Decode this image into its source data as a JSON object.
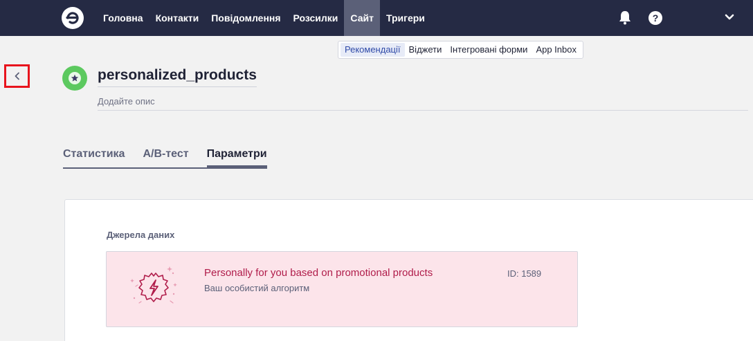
{
  "nav": {
    "items": [
      {
        "label": "Головна"
      },
      {
        "label": "Контакти"
      },
      {
        "label": "Повідомлення"
      },
      {
        "label": "Розсилки"
      },
      {
        "label": "Сайт",
        "active": true
      },
      {
        "label": "Тригери"
      }
    ],
    "icons": [
      "logo-icon",
      "bell-icon",
      "help-icon",
      "chevron-down-icon"
    ],
    "help_glyph": "?"
  },
  "subnav": {
    "items": [
      {
        "label": "Рекомендації",
        "active": true
      },
      {
        "label": "Віджети"
      },
      {
        "label": "Інтегровані форми"
      },
      {
        "label": "App Inbox"
      }
    ]
  },
  "header": {
    "title": "personalized_products",
    "description_placeholder": "Додайте опис",
    "icon": "star-icon"
  },
  "tabs": [
    {
      "label": "Статистика"
    },
    {
      "label": "А/В-тест"
    },
    {
      "label": "Параметри",
      "active": true
    }
  ],
  "data_sources": {
    "section_label": "Джерела даних",
    "items": [
      {
        "name": "Personally for you based on promotional products",
        "subtitle": "Ваш особистий алгоритм",
        "id_text": "ID: 1589",
        "icon": "lightning-badge-icon"
      }
    ]
  },
  "colors": {
    "topbar": "#252a44",
    "active_nav": "#5b6078",
    "accent_green": "#5cc95f",
    "source_bg": "#fce4ea",
    "source_text": "#b01c4a",
    "highlight_red": "#e8141d"
  }
}
